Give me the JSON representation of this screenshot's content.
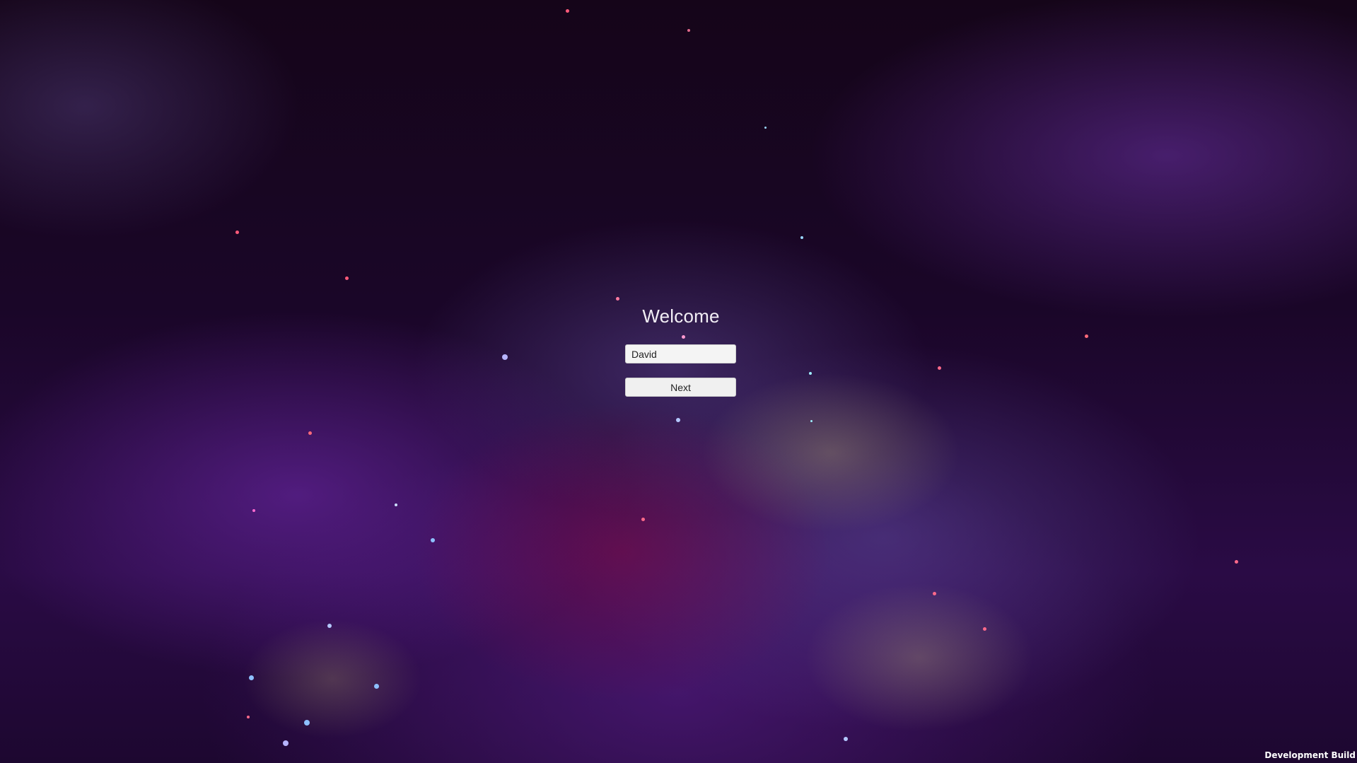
{
  "screen": {
    "title": "Welcome",
    "name_input": {
      "value": "David",
      "placeholder": ""
    },
    "next_button_label": "Next"
  },
  "footer": {
    "build_label": "Development Build"
  },
  "colors": {
    "background_deep": "#150519",
    "nebula_purple": "#6e28aa",
    "nebula_magenta": "#820a46",
    "nebula_gold": "#d6cd78",
    "title_text": "#f2eef5",
    "control_background": "#f4f4f4"
  }
}
